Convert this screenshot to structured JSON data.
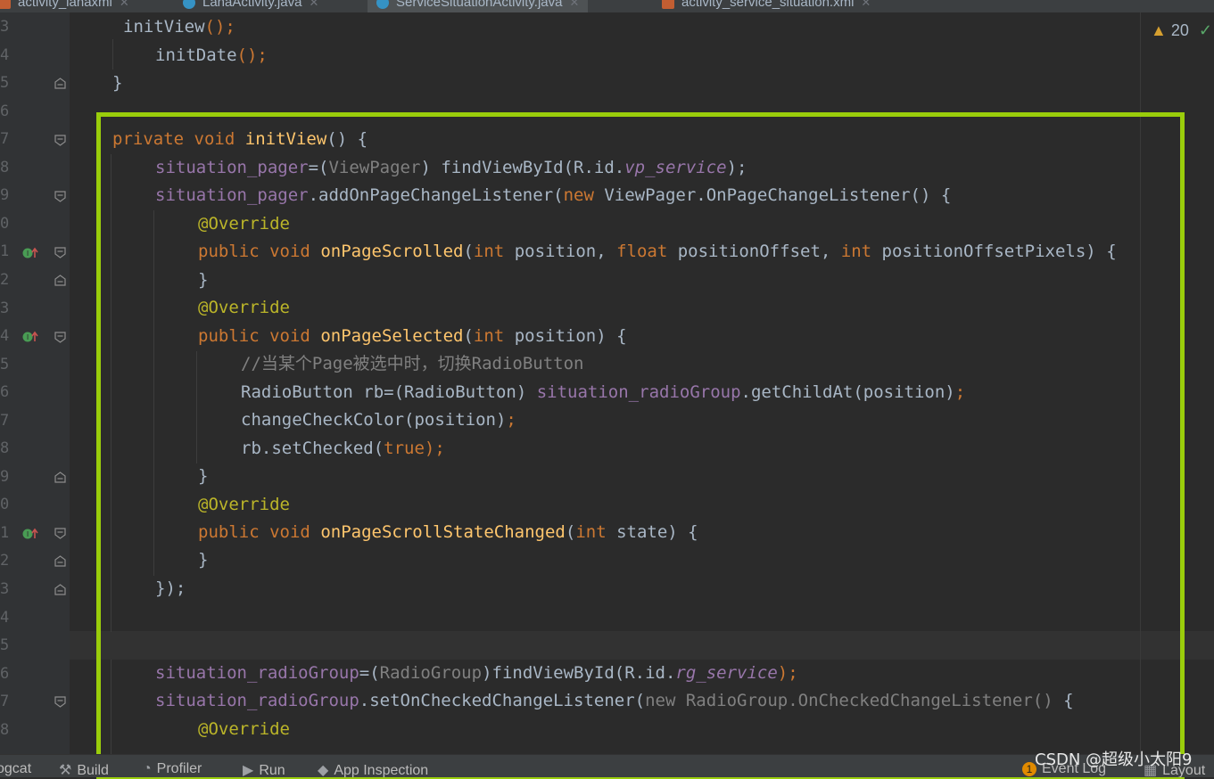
{
  "tabs": [
    {
      "label": "activity_lanaxml",
      "icon": "xml-file-icon",
      "active": false
    },
    {
      "label": "LanaActivity.java",
      "icon": "java-class-icon",
      "active": false
    },
    {
      "label": "ServiceSituationActivity.java",
      "icon": "java-class-icon",
      "active": true
    },
    {
      "label": "activity_service_situation.xml",
      "icon": "xml-layout-icon",
      "active": false
    }
  ],
  "inspection": {
    "warnings": "20"
  },
  "line_numbers": [
    "3",
    "4",
    "5",
    "6",
    "7",
    "8",
    "9",
    "0",
    "1",
    "2",
    "3",
    "4",
    "5",
    "6",
    "7",
    "8",
    "9",
    "0",
    "1",
    "2",
    "3",
    "4",
    "5",
    "6",
    "7",
    "8"
  ],
  "code": {
    "l0": [
      "initView",
      "();"
    ],
    "l1": [
      "initDate",
      "();"
    ],
    "l2": [
      "}"
    ],
    "l4": [
      "private",
      " ",
      "void",
      " ",
      "initView",
      "() {"
    ],
    "l5": [
      "situation_pager",
      "=(",
      "ViewPager",
      ") findViewById(R.id.",
      "vp_service",
      ");"
    ],
    "l6": [
      "situation_pager",
      ".addOnPageChangeListener(",
      "new",
      " ViewPager.OnPageChangeListener() {"
    ],
    "l7": [
      "@Override"
    ],
    "l8": [
      "public",
      " ",
      "void",
      " ",
      "onPageScrolled",
      "(",
      "int",
      " position, ",
      "float",
      " positionOffset, ",
      "int",
      " positionOffsetPixels) {"
    ],
    "l9": [
      "}"
    ],
    "l10": [
      "@Override"
    ],
    "l11": [
      "public",
      " ",
      "void",
      " ",
      "onPageSelected",
      "(",
      "int",
      " position) {"
    ],
    "l12": [
      "//当某个Page被选中时，切换RadioButton"
    ],
    "l13": [
      "RadioButton rb=(RadioButton) ",
      "situation_radioGroup",
      ".getChildAt(position)",
      ";"
    ],
    "l14": [
      "changeCheckColor(position)",
      ";"
    ],
    "l15": [
      "rb.setChecked(",
      "true",
      ");"
    ],
    "l16": [
      "}"
    ],
    "l17": [
      "@Override"
    ],
    "l18": [
      "public",
      " ",
      "void",
      " ",
      "onPageScrollStateChanged",
      "(",
      "int",
      " state) {"
    ],
    "l19": [
      "}"
    ],
    "l20": [
      "});"
    ],
    "l23": [
      "situation_radioGroup",
      "=(",
      "RadioGroup",
      ")findViewById(R.id.",
      "rg_service",
      ");"
    ],
    "l24": [
      "situation_radioGroup",
      ".setOnCheckedChangeListener(",
      "new RadioGroup.OnCheckedChangeListener()",
      " {"
    ],
    "l25": [
      "@Override"
    ]
  },
  "status": {
    "logcat": "ogcat",
    "build": "Build",
    "profiler": "Profiler",
    "run": "Run",
    "app_inspection": "App Inspection",
    "event_log_count": "1",
    "event_log": "Event Log",
    "layout": "Layout"
  },
  "watermark": "CSDN @超级小太阳9",
  "colors": {
    "highlight_box": "#9acd0b",
    "keyword": "#cc7832",
    "function": "#ffc66d",
    "annotation": "#bbb529",
    "field": "#9876aa"
  }
}
